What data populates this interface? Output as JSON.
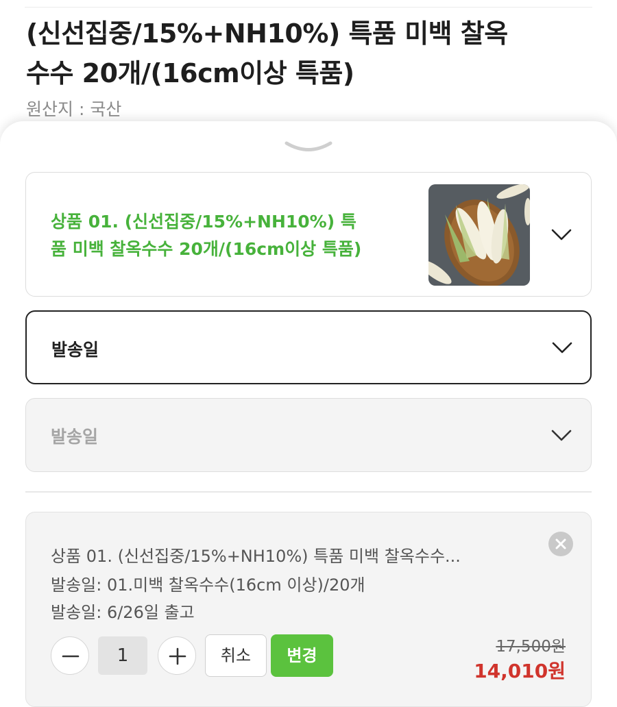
{
  "product": {
    "title_line1": "(신선집중/15%+NH10%) 특품 미백 찰옥",
    "title_line2": "수수 20개/(16cm이상 특품)",
    "origin": "원산지 : 국산"
  },
  "option_card": {
    "title_line1": "상품 01. (신선집중/15%+NH10%) 특",
    "title_line2": "품 미백 찰옥수수 20개/(16cm이상 특품)",
    "thumbnail_icon": "corn-photo"
  },
  "selects": [
    {
      "label": "발송일",
      "state": "active"
    },
    {
      "label": "발송일",
      "state": "disabled"
    }
  ],
  "summary": {
    "product_line": "상품 01. (신선집중/15%+NH10%) 특품 미백 찰옥수수...",
    "option_line1": "발송일: 01.미백 찰옥수수(16cm 이상)/20개",
    "option_line2": "발송일: 6/26일 출고",
    "quantity": "1",
    "cancel_label": "취소",
    "change_label": "변경",
    "original_price": "17,500원",
    "sale_price": "14,010원"
  },
  "colors": {
    "accent_green": "#47b23b",
    "button_green": "#5bc23e",
    "sale_red": "#d0342c"
  }
}
